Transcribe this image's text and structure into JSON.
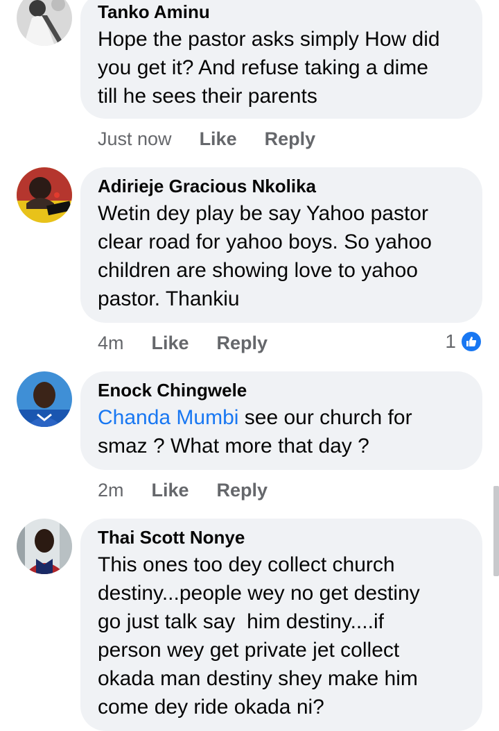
{
  "comments": [
    {
      "name": "Tanko Aminu",
      "lines": [
        "Hope the pastor asks simply How did",
        "you get it? And refuse taking a dime",
        "till he sees their parents"
      ],
      "time": "Just now",
      "like": "Like",
      "reply": "Reply"
    },
    {
      "name": "Adirieje Gracious Nkolika",
      "lines": [
        "Wetin dey play be say Yahoo pastor",
        "clear road for yahoo boys. So yahoo",
        "children are showing love to yahoo",
        "pastor. Thankiu"
      ],
      "time": "4m",
      "like": "Like",
      "reply": "Reply",
      "reaction_count": "1"
    },
    {
      "name": "Enock Chingwele",
      "mention": "Chanda Mumbi",
      "line1_rest": " see our church for",
      "line2": "smaz ? What more that day ?",
      "time": "2m",
      "like": "Like",
      "reply": "Reply"
    },
    {
      "name": "Thai Scott Nonye",
      "lines": [
        "This ones too dey collect church",
        "destiny...people wey no get destiny",
        "go just talk say  him destiny....if",
        "person wey get private jet collect",
        "okada man destiny shey make him",
        "come dey ride okada ni?"
      ]
    }
  ],
  "colors": {
    "bubble": "#f0f2f5",
    "meta": "#65676b",
    "mention": "#1877f2",
    "like_badge": "#1877f2"
  },
  "icons": {
    "reaction": "thumbs-up-icon"
  }
}
